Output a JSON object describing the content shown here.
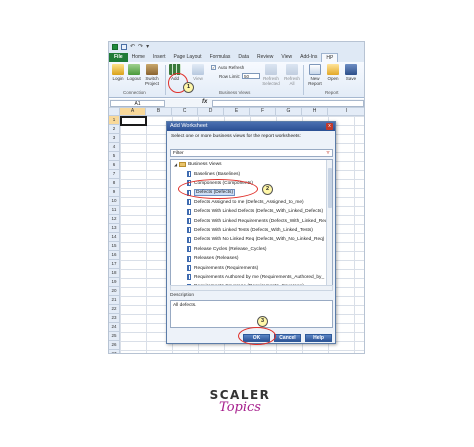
{
  "quick_access": {
    "undo": "↶",
    "redo": "↷",
    "menu": "▾"
  },
  "ribbon_tabs": [
    "File",
    "Home",
    "Insert",
    "Page Layout",
    "Formulas",
    "Data",
    "Review",
    "View",
    "Add-Ins",
    "HP"
  ],
  "ribbon": {
    "login": "Login",
    "logout": "Logout",
    "switch_project": "Switch Project",
    "add": "Add",
    "view": "View",
    "auto_refresh": "Auto Refresh",
    "row_limit_label": "Row Limit:",
    "row_limit_value": "50",
    "refresh_selected": "Refresh Selected",
    "refresh_all": "Refresh All",
    "new_report": "New Report",
    "open": "Open",
    "save": "Save",
    "groups": {
      "connection": "Connection",
      "business_views": "Business Views",
      "report": "Report"
    }
  },
  "formula_bar": {
    "name_box": "A1",
    "fx": "fx",
    "value": ""
  },
  "grid": {
    "columns": [
      "A",
      "B",
      "C",
      "D",
      "E",
      "F",
      "G",
      "H",
      "I"
    ],
    "rows": [
      "1",
      "2",
      "3",
      "4",
      "5",
      "6",
      "7",
      "8",
      "9",
      "10",
      "11",
      "12",
      "13",
      "14",
      "15",
      "16",
      "17",
      "18",
      "19",
      "20",
      "21",
      "22",
      "23",
      "24",
      "25",
      "26",
      "27",
      "28"
    ]
  },
  "dialog": {
    "title": "Add Worksheet",
    "close": "x",
    "prompt": "Select one or more business views for the report worksheets:",
    "filter_label": "Filter",
    "filter_icon": "funnel-icon",
    "tree_root": "Business Views",
    "items": [
      "Baselines (Baselines)",
      "Components (Components)",
      "Defects (Defects)",
      "Defects Assigned to me (Defects_Assigned_to_me)",
      "Defects With Linked Defects (Defects_With_Linked_Defects)",
      "Defects With Linked Requirements (Defects_With_Linked_Req",
      "Defects With Linked Tests (Defects_With_Linked_Tests)",
      "Defects With No Linked Req (Defects_With_No_Linked_Req)",
      "Release Cycles (Release_Cycles)",
      "Releases (Releases)",
      "Requirements (Requirements)",
      "Requirements Authored by me (Requirements_Authored_by_",
      "Requirements Coverage (Requirements_Coverage)"
    ],
    "selected_index": 2,
    "description_label": "Description",
    "description": "All defects.",
    "ok": "OK",
    "cancel": "Cancel",
    "help": "Help"
  },
  "callouts": [
    "1",
    "2",
    "3"
  ],
  "logo": {
    "main": "SCALER",
    "sub": "Topics"
  },
  "colors": {
    "file_tab": "#1f7a37",
    "dialog_title": "#2a4f93",
    "callout_ring": "#e0302a",
    "logo_accent": "#a61e8c"
  }
}
